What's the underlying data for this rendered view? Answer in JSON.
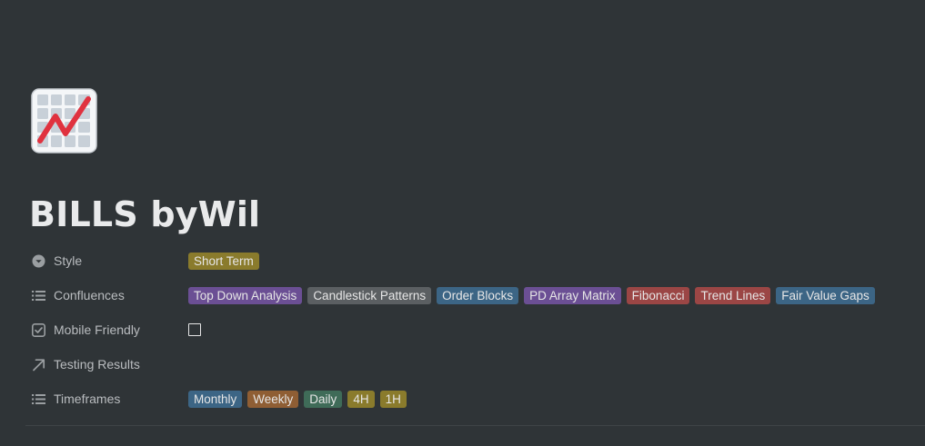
{
  "page": {
    "title": "BILLS byWil",
    "icon": "chart-increasing-icon"
  },
  "properties": [
    {
      "key": "style",
      "label": "Style",
      "icon": "select-icon",
      "tags": [
        {
          "label": "Short Term",
          "color": "#8a7b2c"
        }
      ]
    },
    {
      "key": "confluences",
      "label": "Confluences",
      "icon": "multi-select-icon",
      "tags": [
        {
          "label": "Top Down Analysis",
          "color": "#6b4f94"
        },
        {
          "label": "Candlestick Patterns",
          "color": "#5b5f62"
        },
        {
          "label": "Order Blocks",
          "color": "#3c6585"
        },
        {
          "label": "PD Array Matrix",
          "color": "#6b4f94"
        },
        {
          "label": "Fibonacci",
          "color": "#9b4645"
        },
        {
          "label": "Trend Lines",
          "color": "#9b4645"
        },
        {
          "label": "Fair Value Gaps",
          "color": "#3c6585"
        }
      ]
    },
    {
      "key": "mobile_friendly",
      "label": "Mobile Friendly",
      "icon": "checkbox-icon",
      "checked": false
    },
    {
      "key": "testing_results",
      "label": "Testing Results",
      "icon": "arrow-up-right-icon"
    },
    {
      "key": "timeframes",
      "label": "Timeframes",
      "icon": "multi-select-icon",
      "tags": [
        {
          "label": "Monthly",
          "color": "#3c6585"
        },
        {
          "label": "Weekly",
          "color": "#8f5e34"
        },
        {
          "label": "Daily",
          "color": "#3f6b58"
        },
        {
          "label": "4H",
          "color": "#8a7b2c"
        },
        {
          "label": "1H",
          "color": "#8a7b2c"
        }
      ]
    }
  ]
}
